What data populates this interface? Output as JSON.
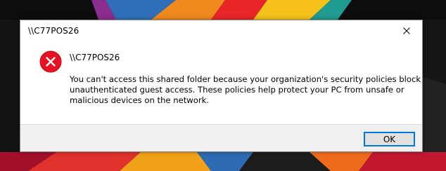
{
  "window": {
    "title": "\\\\C77POS26",
    "close_icon": "close-icon"
  },
  "dialog": {
    "icon": "error-icon",
    "heading": "\\\\C77POS26",
    "message": "You can't access this shared folder because your organization's security policies block unauthenticated guest access. These policies help protect your PC from unsafe or malicious devices on the network."
  },
  "buttons": {
    "ok_label": "OK"
  },
  "colors": {
    "error_red": "#e81123",
    "accent": "#0078d7",
    "footer_bg": "#f0f0f0"
  }
}
